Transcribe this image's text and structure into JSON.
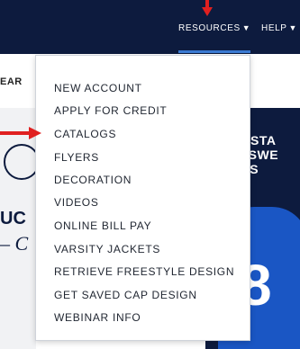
{
  "nav": {
    "resources_label": "RESOURCES",
    "help_label": "HELP",
    "caret": "▼"
  },
  "background": {
    "clipped_heading": "EAR",
    "left_promo_line1": "UC",
    "left_promo_line2": "– C",
    "right_promo_lines": [
      "GUSTA",
      "RTSWE",
      "NDS"
    ],
    "right_promo_number": "8"
  },
  "dropdown": {
    "items": [
      "NEW ACCOUNT",
      "APPLY FOR CREDIT",
      "CATALOGS",
      "FLYERS",
      "DECORATION",
      "VIDEOS",
      "ONLINE BILL PAY",
      "VARSITY JACKETS",
      "RETRIEVE FREESTYLE DESIGN",
      "GET SAVED CAP DESIGN",
      "WEBINAR INFO"
    ]
  },
  "colors": {
    "nav_background": "#0d1b3e",
    "accent_underline": "#3b7bd4",
    "annotation_arrow": "#e02020"
  }
}
